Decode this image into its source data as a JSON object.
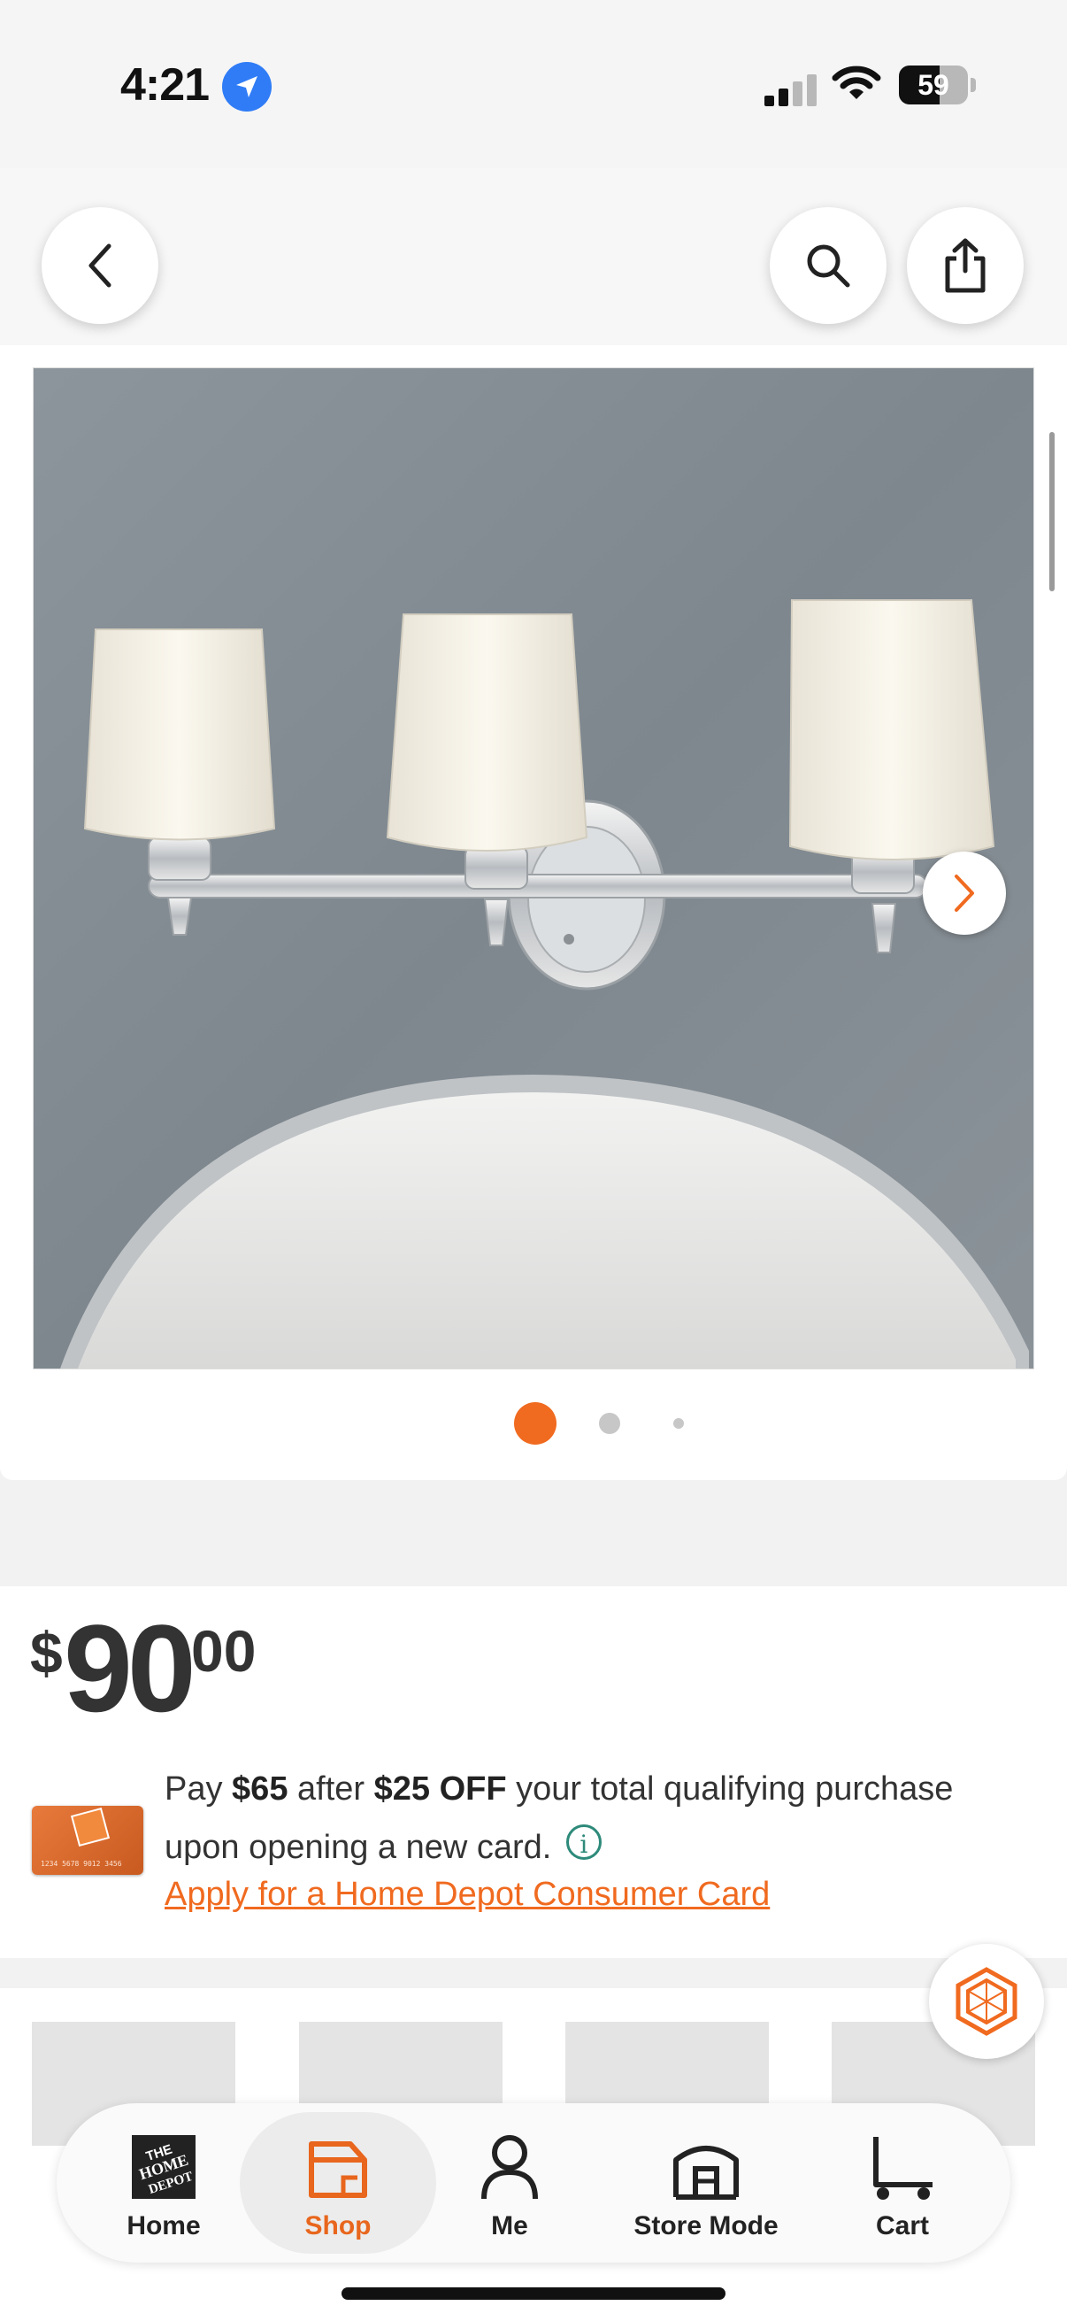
{
  "status_bar": {
    "time": "4:21",
    "battery_level": "59",
    "icons": [
      "location-arrow-icon",
      "cellular-signal-icon",
      "wifi-icon",
      "battery-icon"
    ]
  },
  "top_nav": {
    "back_icon": "chevron-left-icon",
    "search_icon": "search-icon",
    "share_icon": "share-icon"
  },
  "gallery": {
    "image_alt": "Three-light vanity light fixture with frosted glass shades above an oval mirror",
    "next_icon": "chevron-right-icon",
    "page_count": 3,
    "active_index": 0
  },
  "price": {
    "dollar_sign": "$",
    "whole": "90",
    "cents": "00"
  },
  "promo": {
    "text_1": "Pay ",
    "amount": "$65",
    "text_2": " after ",
    "discount": "$25 OFF",
    "text_3": " your total qualifying purchase upon opening a new card.",
    "link": "Apply for a Home Depot Consumer Card",
    "card_number": "1234 5678 9012 3456"
  },
  "tab_bar": {
    "items": [
      {
        "label": "Home",
        "icon": "home-depot-logo-icon"
      },
      {
        "label": "Shop",
        "icon": "shop-icon"
      },
      {
        "label": "Me",
        "icon": "person-icon"
      },
      {
        "label": "Store Mode",
        "icon": "store-icon"
      },
      {
        "label": "Cart",
        "icon": "cart-icon"
      }
    ],
    "active": "Shop"
  },
  "colors": {
    "accent": "#f96302",
    "link": "#f06a1f",
    "background": "#f2f2f2"
  }
}
